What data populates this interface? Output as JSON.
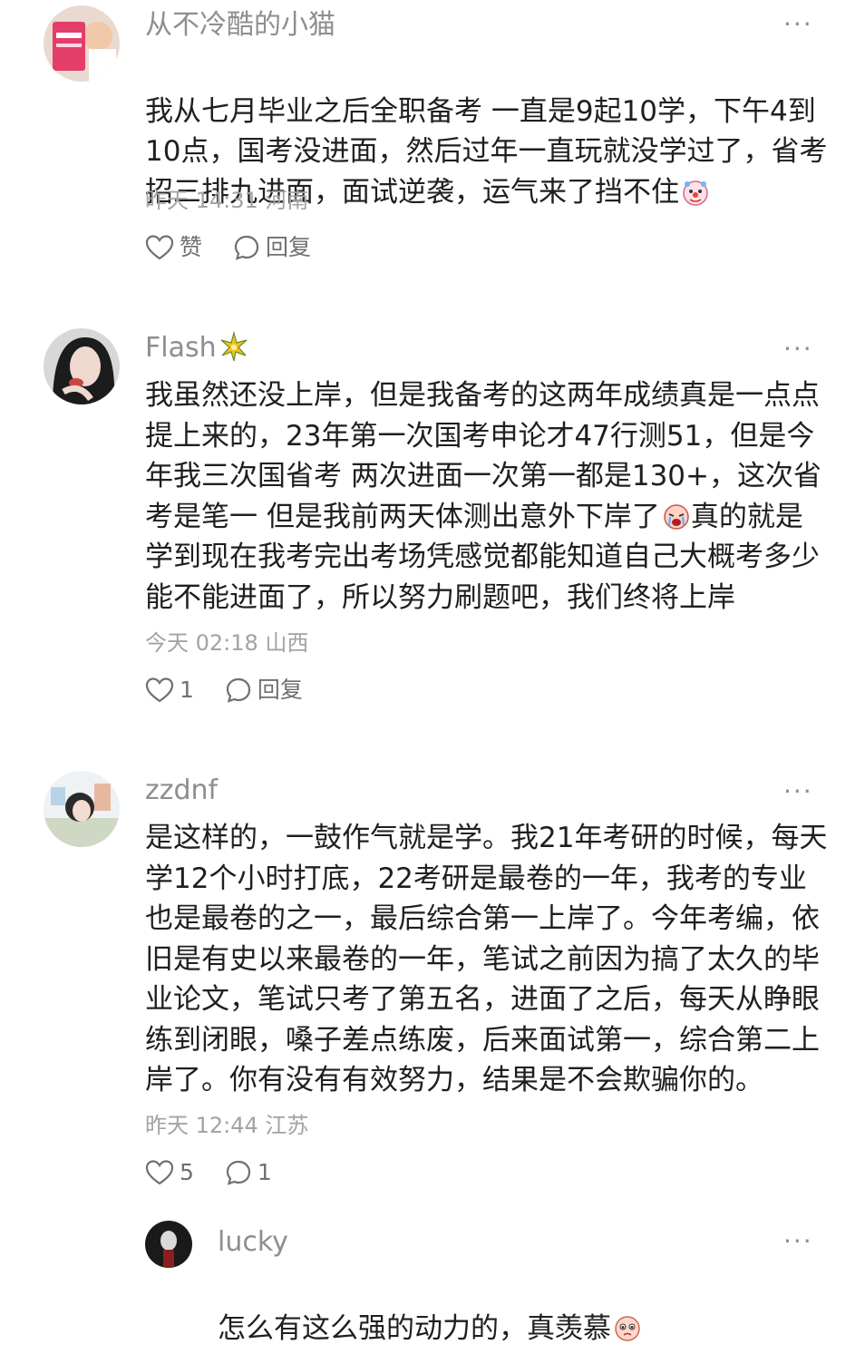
{
  "comments": [
    {
      "username": "从不冷酷的小猫",
      "content": "我从七月毕业之后全职备考 一直是9起10学，下午4到\n10点，国考没进面，然后过年一直玩就没学过了，省考\n招三排九进面，面试逆袭，运气来了挡不住",
      "emoji": "clown-face",
      "meta": "昨天 14:31 河南",
      "like_label": "赞",
      "reply_label": "回复"
    },
    {
      "username": "Flash",
      "username_badge": "sparkle-star",
      "content": "我虽然还没上岸，但是我备考的这两年成绩真是一点点\n提上来的，23年第一次国考申论才47行测51，但是今\n年我三次国省考 两次进面一次第一都是130+，这次省\n考是笔一 但是我前两天体测出意外下岸了{E}真的就是\n学到现在我考完出考场凭感觉都能知道自己大概考多少\n能不能进面了，所以努力刷题吧，我们终将上岸",
      "emoji": "crying-face",
      "meta": "今天 02:18 山西",
      "like_label": "1",
      "reply_label": "回复"
    },
    {
      "username": "zzdnf",
      "content": "是这样的，一鼓作气就是学。我21年考研的时候，每天\n学12个小时打底，22考研是最卷的一年，我考的专业\n也是最卷的之一，最后综合第一上岸了。今年考编，依\n旧是有史以来最卷的一年，笔试之前因为搞了太久的毕\n业论文，笔试只考了第五名，进面了之后，每天从睁眼\n练到闭眼，嗓子差点练废，后来面试第一，综合第二上\n岸了。你有没有有效努力，结果是不会欺骗你的。",
      "meta": "昨天 12:44 江苏",
      "like_label": "5",
      "reply_label": "1"
    }
  ],
  "reply": {
    "username": "lucky",
    "content": "怎么有这么强的动力的，真羡慕",
    "emoji": "pleading-face"
  },
  "more_label": "···",
  "colors": {
    "text": "#1f1f1f",
    "username": "#8e8e8e",
    "meta": "#a3a3a3",
    "action": "#6f6f6f"
  }
}
